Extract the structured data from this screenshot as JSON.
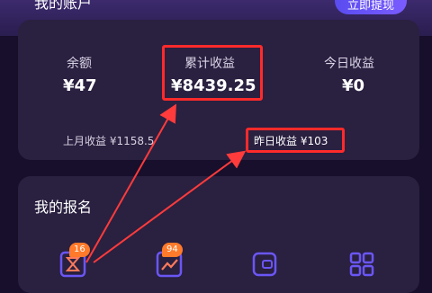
{
  "header": {
    "title": "我的账户",
    "withdraw_label": "立即提现"
  },
  "account": {
    "balance_label": "余额",
    "balance_value": "¥47",
    "total_label": "累计收益",
    "total_value": "¥8439.25",
    "today_label": "今日收益",
    "today_value": "¥0",
    "last_month_text": "上月收益 ¥1158.5",
    "yesterday_text": "昨日收益 ¥103"
  },
  "signup": {
    "title": "我的报名",
    "items": [
      {
        "icon": "hourglass-icon",
        "badge": "16"
      },
      {
        "icon": "chart-up-icon",
        "badge": "94"
      },
      {
        "icon": "wallet-icon",
        "badge": ""
      },
      {
        "icon": "grid-icon",
        "badge": ""
      }
    ]
  },
  "colors": {
    "highlight": "#ff2a2a",
    "badge": "#ff7a2a",
    "accent_purple": "#6a56f5"
  }
}
